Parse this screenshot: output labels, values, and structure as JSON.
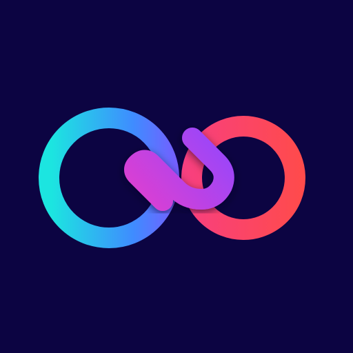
{
  "icon": {
    "name": "infinity-link-logo-icon",
    "colors": {
      "background": "#0C0442",
      "cyan": "#1CE5E0",
      "blue": "#3F8CFF",
      "violet": "#9146FF",
      "magenta": "#EC3FC8",
      "pink": "#F53C8E",
      "red": "#FF4B4B"
    }
  }
}
